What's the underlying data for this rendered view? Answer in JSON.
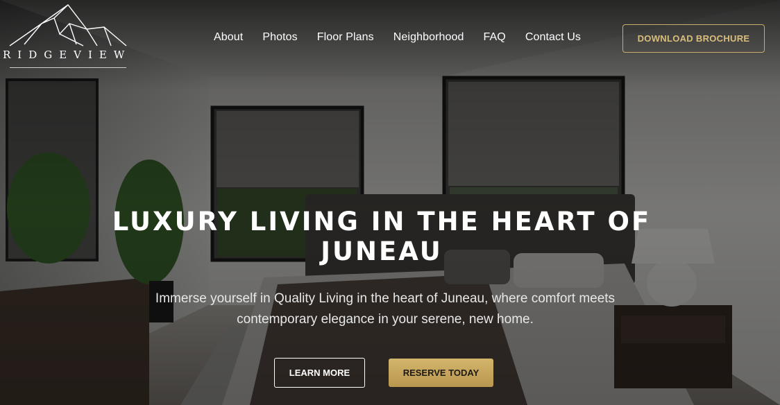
{
  "brand": {
    "name": "RIDGEVIEW"
  },
  "nav": {
    "items": [
      {
        "label": "About"
      },
      {
        "label": "Photos"
      },
      {
        "label": "Floor Plans"
      },
      {
        "label": "Neighborhood"
      },
      {
        "label": "FAQ"
      },
      {
        "label": "Contact Us"
      }
    ],
    "cta_label": "DOWNLOAD BROCHURE"
  },
  "hero": {
    "headline_line1": "LUXURY LIVING IN THE HEART OF",
    "headline_line2": "JUNEAU",
    "subtitle_line1": "Immerse yourself in Quality Living in the heart of Juneau, where comfort meets",
    "subtitle_line2": "contemporary elegance in your serene, new home.",
    "learn_more_label": "LEARN MORE",
    "reserve_label": "RESERVE TODAY"
  },
  "colors": {
    "accent_gold": "#c9ad6a",
    "overlay": "#000000",
    "text": "#ffffff"
  }
}
